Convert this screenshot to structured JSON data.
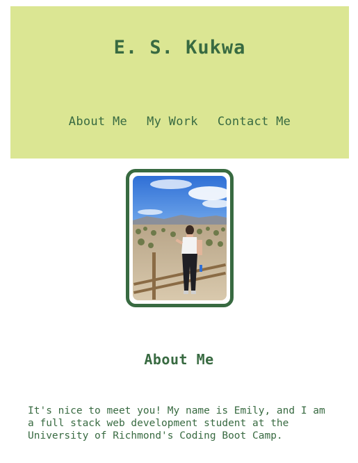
{
  "header": {
    "title": "E. S. Kukwa",
    "nav": [
      {
        "label": "About Me"
      },
      {
        "label": "My Work"
      },
      {
        "label": "Contact Me"
      }
    ]
  },
  "profile_photo": {
    "description_icon": "profile-photo"
  },
  "about": {
    "heading": "About Me",
    "text": "It's nice to meet you! My name is Emily, and I am a full stack web development student at the University of Richmond's Coding Boot Camp."
  },
  "colors": {
    "accent": "#386a41",
    "header_bg": "#dbe693",
    "background": "#ffffff"
  }
}
